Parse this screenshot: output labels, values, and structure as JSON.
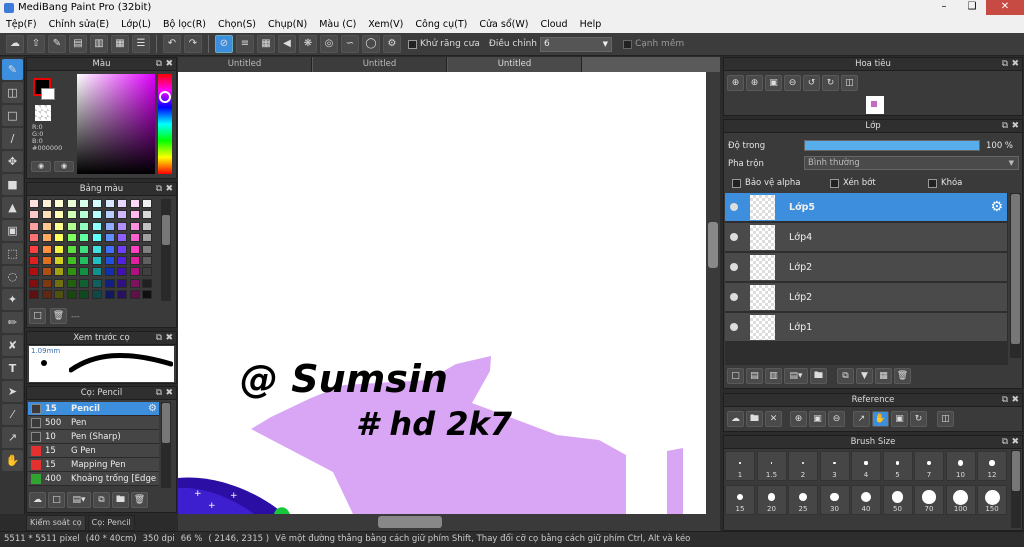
{
  "window": {
    "title": "MediBang Paint Pro (32bit)"
  },
  "menu": [
    "Tệp(F)",
    "Chỉnh sửa(E)",
    "Lớp(L)",
    "Bộ lọc(R)",
    "Chọn(S)",
    "Chụp(N)",
    "Màu (C)",
    "Xem(V)",
    "Công cụ(T)",
    "Cửa sổ(W)",
    "Cloud",
    "Help"
  ],
  "toolbar": {
    "antialias_label": "Khử răng cưa",
    "correction_label": "Điều chỉnh",
    "correction_value": "6",
    "sharp_edge_label": "Cạnh mềm"
  },
  "color_panel": {
    "title": "Màu",
    "r": "R:0",
    "g": "G:0",
    "b": "B:0",
    "hex": "#000000"
  },
  "palette_panel": {
    "title": "Bảng màu",
    "footer": "---"
  },
  "preview_panel": {
    "title": "Xem trước cọ",
    "size": "1.09mm"
  },
  "brush_panel": {
    "title": "Cọ: Pencil",
    "brushes": [
      {
        "size": "15",
        "name": "Pencil",
        "color": "#3a3a3a"
      },
      {
        "size": "500",
        "name": "Pen",
        "color": "#3a3a3a"
      },
      {
        "size": "10",
        "name": "Pen (Sharp)",
        "color": "#3a3a3a"
      },
      {
        "size": "15",
        "name": "G Pen",
        "color": "#e53030"
      },
      {
        "size": "15",
        "name": "Mapping Pen",
        "color": "#e53030"
      },
      {
        "size": "400",
        "name": "Khoảng trống [Edge",
        "color": "#2fa52f"
      }
    ]
  },
  "bottom_tabs": [
    "Kiểm soát cọ",
    "Cọ: Pencil"
  ],
  "canvas_tabs": [
    "Untitled",
    "Untitled",
    "Untitled"
  ],
  "canvas_text": {
    "line1": "@ Sumsin",
    "line2": "# hd 2k7"
  },
  "navigator_panel": {
    "title": "Hoa tiêu"
  },
  "layer_panel": {
    "title": "Lớp",
    "opacity_label": "Độ trong",
    "opacity_value": "100 %",
    "opacity_fraction": 1.0,
    "blend_label": "Pha trộn",
    "blend_value": "Bình thường",
    "protect_alpha": "Bảo vệ alpha",
    "clipping": "Xén bớt",
    "lock": "Khóa",
    "layers": [
      "Lớp5",
      "Lớp4",
      "Lớp2",
      "Lớp2",
      "Lớp1"
    ]
  },
  "reference_panel": {
    "title": "Reference"
  },
  "brush_size_panel": {
    "title": "Brush Size",
    "sizes": [
      "1",
      "1.5",
      "2",
      "3",
      "4",
      "5",
      "7",
      "10",
      "12",
      "15",
      "20",
      "25",
      "30",
      "40",
      "50",
      "70",
      "100",
      "150"
    ]
  },
  "status": {
    "dims": "5511 * 5511 pixel",
    "cm": "(40 * 40cm)",
    "dpi": "350 dpi",
    "zoom": "66 %",
    "coords": "( 2146, 2315 )",
    "hint": "Vẽ một đường thẳng bằng cách giữ phím Shift, Thay đổi cỡ cọ bằng cách giữ phím Ctrl, Alt và kéo"
  },
  "colors": {
    "accent": "#3d8fdd",
    "lavender": "#d9a6f5",
    "navy": "#2b0ea3"
  }
}
